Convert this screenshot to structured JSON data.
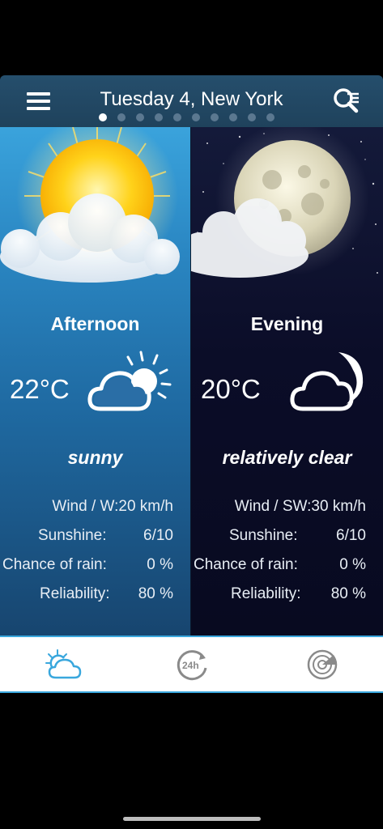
{
  "header": {
    "title": "Tuesday 4, New York",
    "page_count": 10,
    "active_page": 0,
    "menu_icon": "hamburger-menu-icon",
    "search_icon": "search-list-icon"
  },
  "panels": [
    {
      "period": "Afternoon",
      "temperature": "22°C",
      "description": "sunny",
      "hero_icon": "sun-with-cloud-icon",
      "condition_icon": "cloud-sun-icon",
      "stats": {
        "wind": "Wind / W:20 km/h",
        "sunshine_label": "Sunshine:",
        "sunshine_value": "6/10",
        "rain_label": "Chance of rain:",
        "rain_value": "0 %",
        "reliability_label": "Reliability:",
        "reliability_value": "80 %"
      }
    },
    {
      "period": "Evening",
      "temperature": "20°C",
      "description": "relatively clear",
      "hero_icon": "moon-with-cloud-icon",
      "condition_icon": "cloud-moon-icon",
      "stats": {
        "wind": "Wind / SW:30 km/h",
        "sunshine_label": "Sunshine:",
        "sunshine_value": "6/10",
        "rain_label": "Chance of rain:",
        "rain_value": "0 %",
        "reliability_label": "Reliability:",
        "reliability_value": "80 %"
      }
    }
  ],
  "bottom_nav": {
    "items": [
      {
        "icon": "weather-cloud-sun-icon",
        "active": true
      },
      {
        "icon": "forecast-24h-icon",
        "active": false
      },
      {
        "icon": "radar-icon",
        "active": false
      }
    ]
  },
  "colors": {
    "accent": "#39a7dd",
    "header": "#234a67",
    "afternoon_top": "#3aa3dc",
    "evening_bg": "#0b0d28"
  }
}
